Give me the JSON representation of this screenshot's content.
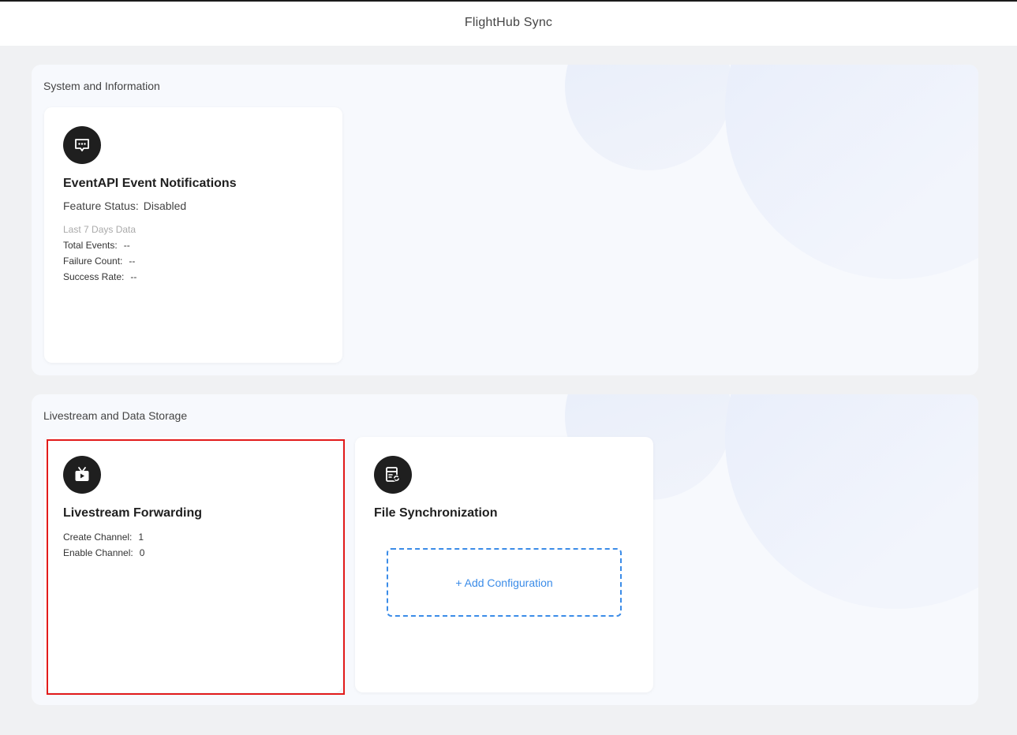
{
  "app": {
    "title": "FlightHub Sync"
  },
  "sections": [
    {
      "title": "System and Information",
      "cards": [
        {
          "icon": "chat-bubble-icon",
          "title": "EventAPI Event Notifications",
          "feature_status_label": "Feature Status:",
          "feature_status_value": "Disabled",
          "stats_caption": "Last 7 Days Data",
          "stats": [
            {
              "label": "Total Events:",
              "value": "--"
            },
            {
              "label": "Failure Count:",
              "value": "--"
            },
            {
              "label": "Success Rate:",
              "value": "--"
            }
          ]
        }
      ]
    },
    {
      "title": "Livestream and Data Storage",
      "cards": [
        {
          "icon": "tv-play-icon",
          "title": "Livestream Forwarding",
          "stats": [
            {
              "label": "Create Channel:",
              "value": "1"
            },
            {
              "label": "Enable Channel:",
              "value": "0"
            }
          ]
        },
        {
          "icon": "file-sync-icon",
          "title": "File Synchronization",
          "add_config_label": "+ Add Configuration"
        }
      ]
    }
  ],
  "colors": {
    "accent": "#3b8ce8",
    "highlight": "#e21b1b",
    "icon_bg": "#1f1f1f"
  }
}
